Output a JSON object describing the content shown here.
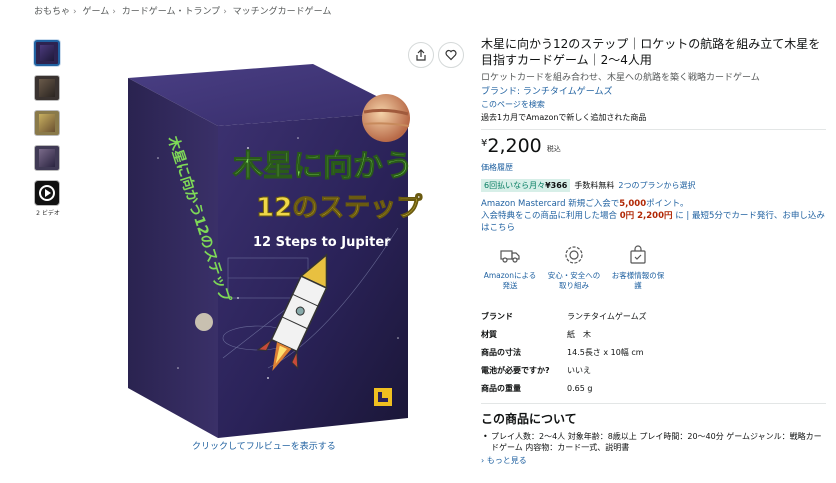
{
  "breadcrumb": [
    "おもちゃ",
    "ゲーム",
    "カードゲーム・トランプ",
    "マッチングカードゲーム"
  ],
  "breadcrumb_sep": "›",
  "thumbnails": {
    "video_label": "2 ビデオ"
  },
  "image": {
    "box_title_line1": "木星に向かう",
    "box_title_line2": "12のステップ",
    "box_english": "12 Steps to Jupiter",
    "box_side": "木星に向かう12のステップ",
    "fullview_link": "クリックしてフルビューを表示する"
  },
  "product": {
    "title": "木星に向かう12のステップ｜ロケットの航路を組み立て木星を目指すカードゲーム｜2～4人用",
    "subtitle": "ロケットカードを組み合わせ、木星への航路を築く戦略カードゲーム",
    "brand_link": "ブランド: ランチタイムゲームズ",
    "search_page": "このページを検索",
    "new_note": "過去1カ月でAmazonで新しく追加された商品",
    "price_symbol": "¥",
    "price_amount": "2,200",
    "price_tax": "税込",
    "price_history": "価格履歴",
    "installment_prefix": "6回払いなら月々",
    "installment_amount": "¥366",
    "installment_fee": "手数料無料",
    "installment_link": "2つのプランから選択",
    "card_line1_a": "Amazon Mastercard 新規ご入会で",
    "card_line1_b": "5,000",
    "card_line1_c": "ポイント。",
    "card_line2_a": "入会特典をこの商品に利用した場合",
    "card_line2_b": "0円 2,200円",
    "card_line2_c": "に | 最短5分でカード発行、お申し込みはこちら"
  },
  "features": [
    {
      "icon": "truck-icon",
      "label": "Amazonによる発送"
    },
    {
      "icon": "shield-badge-icon",
      "label": "安心・安全への取り組み"
    },
    {
      "icon": "shopping-bag-icon",
      "label": "お客様情報の保護"
    }
  ],
  "specs": [
    {
      "key": "ブランド",
      "value": "ランチタイムゲームズ"
    },
    {
      "key": "材質",
      "value": "紙　木"
    },
    {
      "key": "商品の寸法",
      "value": "14.5長さ x 10幅 cm"
    },
    {
      "key": "電池が必要ですか?",
      "value": "いいえ"
    },
    {
      "key": "商品の重量",
      "value": "0.65 g"
    }
  ],
  "about": {
    "heading": "この商品について",
    "bullets": [
      "プレイ人数：2～4人 対象年齢：8歳以上 プレイ時間：20～40分 ゲームジャンル：戦略カードゲーム 内容物：カード一式、説明書"
    ],
    "more_link": "もっと見る"
  }
}
